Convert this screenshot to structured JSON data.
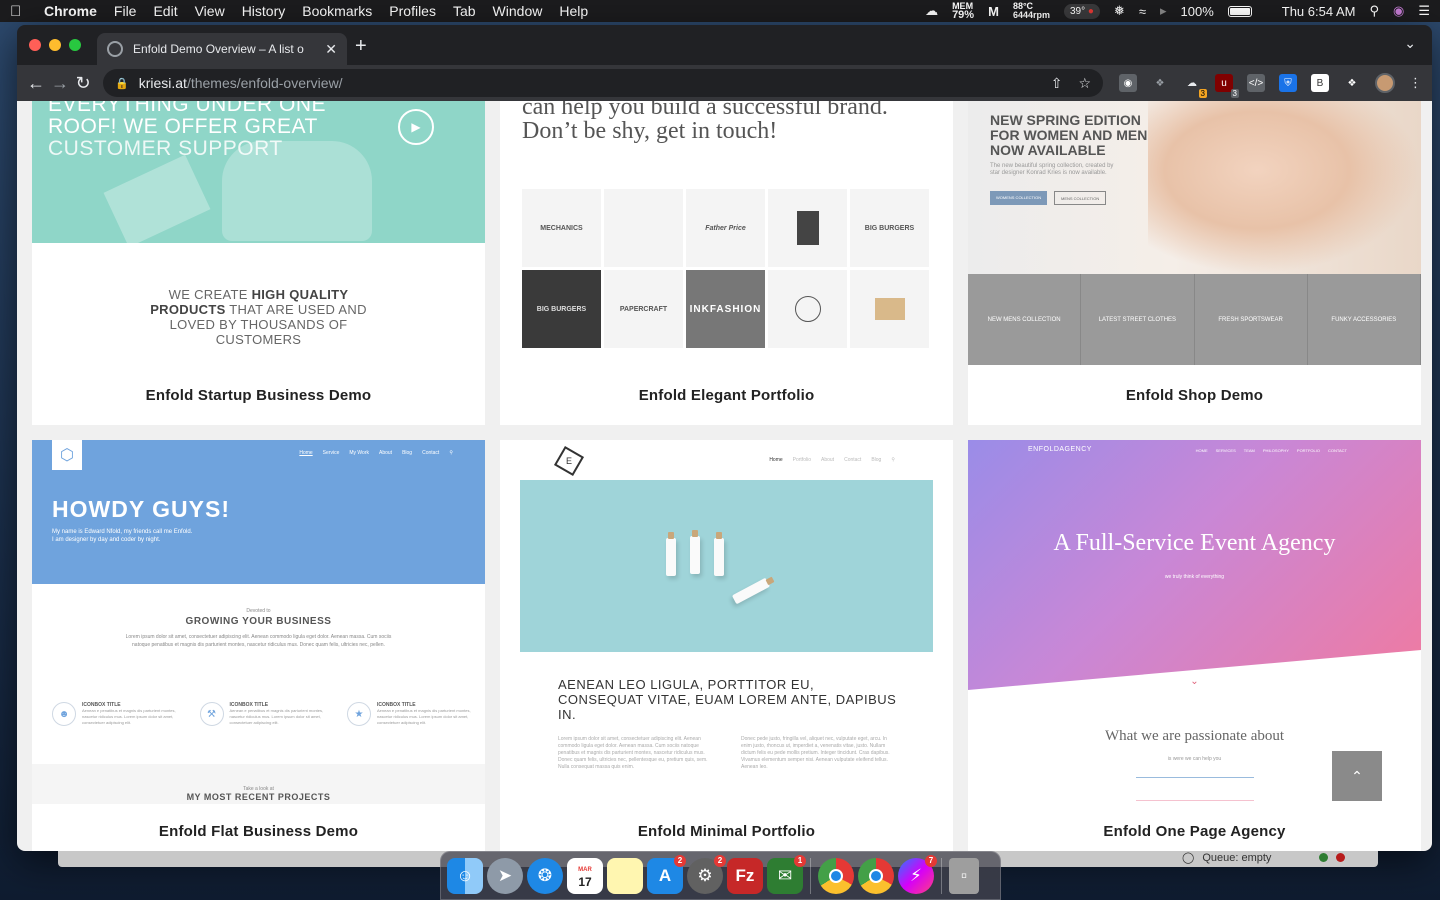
{
  "menubar": {
    "app": "Chrome",
    "menus": [
      "File",
      "Edit",
      "View",
      "History",
      "Bookmarks",
      "Profiles",
      "Tab",
      "Window",
      "Help"
    ],
    "mem_label": "MEM",
    "mem_value": "79%",
    "temp": "88°C",
    "rpm": "6444rpm",
    "weather": "39°",
    "battery": "100%",
    "clock": "Thu 6:54 AM"
  },
  "tab": {
    "title": "Enfold Demo Overview – A list o",
    "close": "✕",
    "new": "+"
  },
  "address": {
    "host": "kriesi.at",
    "path": "/themes/enfold-overview/"
  },
  "extensions": {
    "badge_a": "3",
    "badge_b": "3",
    "b_label": "B",
    "code_label": "</>"
  },
  "cards": {
    "startup": {
      "label": "Enfold Startup Business Demo",
      "hero_lines": [
        "EVERYTHING UNDER ONE",
        "ROOF! WE OFFER GREAT",
        "CUSTOMER SUPPORT"
      ],
      "text_1": "WE CREATE ",
      "text_bold_1": "HIGH QUALITY",
      "text_bold_2": "PRODUCTS",
      "text_2": " THAT ARE USED AND",
      "text_3": "LOVED BY THOUSANDS OF",
      "text_4": "CUSTOMERS"
    },
    "elegant": {
      "label": "Enfold Elegant Portfolio",
      "head_1": "can help you build a successful brand.",
      "head_2": "Don’t be shy, get in touch!",
      "tiles": [
        "MECHANICS",
        "",
        "Father Price",
        "",
        "BIG BURGERS",
        "BIG BURGERS",
        "PAPERCRAFT",
        "INKFASHION",
        "",
        ""
      ]
    },
    "shop": {
      "label": "Enfold Shop Demo",
      "title": [
        "NEW SPRING EDITION",
        "FOR WOMEN AND MEN",
        "NOW AVAILABLE"
      ],
      "sub": "The new beautiful spring collection, created by star designer Konrad Kries is now available.",
      "btn_women": "WOMENS COLLECTION",
      "btn_men": "MENS COLLECTION",
      "strip": [
        "NEW MENS COLLECTION",
        "LATEST STREET CLOTHES",
        "FRESH SPORTSWEAR",
        "FUNKY ACCESSORIES"
      ]
    },
    "flat": {
      "label": "Enfold Flat Business Demo",
      "nav": [
        "Home",
        "Service",
        "My Work",
        "About",
        "Blog",
        "Contact"
      ],
      "headline": "HOWDY GUYS!",
      "intro_1": "My name is Edward Nfold, my friends call me Enfold.",
      "intro_2": "I am designer by day and coder by night.",
      "devoted": "Devoted to",
      "growing": "GROWING YOUR BUSINESS",
      "lorem": "Lorem ipsum dolor sit amet, consectetuer adipiscing elit. Aenean commodo ligula eget dolor. Aenean massa. Cum sociis natoque penatibus et magnis dis parturient montes, nascetur ridiculus mus. Donec quam felis, ultricies nec, pellen.",
      "iconbox_title": "ICONBOX TITLE",
      "iconbox_text": "Aenean e penatibus et magnis dis parturient montes, nascetur ridiculus mus. Lorem ipsum dolor sit amet, consectetuer adipiscing elit.",
      "take_look": "Take a look at",
      "recent": "MY MOST RECENT PROJECTS"
    },
    "minimal": {
      "label": "Enfold Minimal Portfolio",
      "logo": "E",
      "nav": [
        "Home",
        "Portfolio",
        "About",
        "Contact",
        "Blog"
      ],
      "title": "AENEAN LEO LIGULA, PORTTITOR EU, CONSEQUAT VITAE, EUAM LOREM ANTE, DAPIBUS IN.",
      "col_1": "Lorem ipsum dolor sit amet, consectetuer adipiscing elit. Aenean commodo ligula eget dolor. Aenean massa. Cum sociis natoque penatibus et magnis dis parturient montes, nascetur ridiculus mus. Donec quam felis, ultricies nec, pellentesque eu, pretium quis, sem. Nulla consequat massa quis enim.",
      "col_2": "Donec pede justo, fringilla vel, aliquet nec, vulputate eget, arcu. In enim justo, rhoncus ut, imperdiet a, venenatis vitae, justo. Nullam dictum felis eu pede mollis pretium. Integer tincidunt. Cras dapibus. Vivamus elementum semper nisi. Aenean vulputate eleifend tellus. Aenean leo."
    },
    "agency": {
      "label": "Enfold One Page Agency",
      "logo": "ENFOLDAGENCY",
      "nav": [
        "HOME",
        "SERVICES",
        "TEAM",
        "PHILOSOPHY",
        "PORTFOLIO",
        "CONTACT"
      ],
      "headline": "A Full-Service Event Agency",
      "sub": "we truly think of everything",
      "passion": "What we are passionate about",
      "passion_sub": "is were we can help you"
    }
  },
  "queue": "Queue: empty",
  "dock": {
    "calendar_month": "MAR",
    "calendar_day": "17",
    "badges": {
      "appstore": "2",
      "prefs": "2",
      "messages": "1",
      "messenger": "7"
    },
    "filezilla": "Fz"
  },
  "colors": {
    "startup_teal": "#8fd6c8",
    "flat_blue": "#6fa3dd",
    "minimal_cyan": "#9fd4d9",
    "agency_pink": "#f07aa0",
    "agency_purple": "#9a8ce8"
  }
}
